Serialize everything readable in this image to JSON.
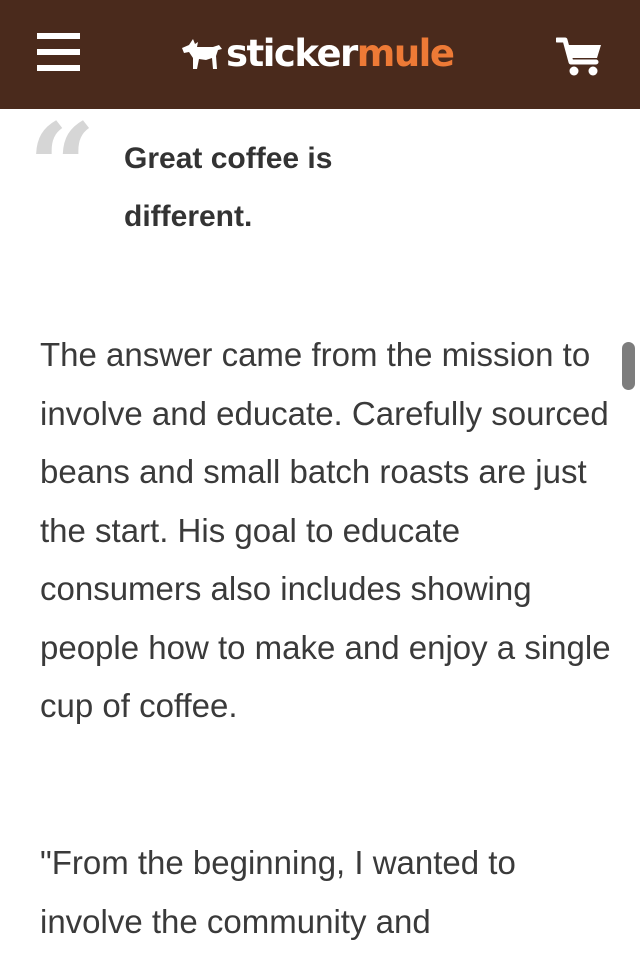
{
  "header": {
    "brand": {
      "part1": "sticker",
      "part2": "mule"
    },
    "menu_icon": "hamburger-menu-icon",
    "logo_icon": "mule-icon",
    "cart_icon": "shopping-cart-icon",
    "colors": {
      "background": "#4a2a1c",
      "brand_accent": "#ee7a36"
    }
  },
  "article": {
    "quote_mark": "“",
    "pull_quote": "Great coffee is different.",
    "paragraphs": [
      "The answer came from the mission to involve and educate. Carefully sourced beans and small batch roasts are just the start. His goal to educate consumers also includes showing people how to make and enjoy a single cup of coffee.",
      "\"From the beginning, I wanted to involve the community and"
    ]
  }
}
